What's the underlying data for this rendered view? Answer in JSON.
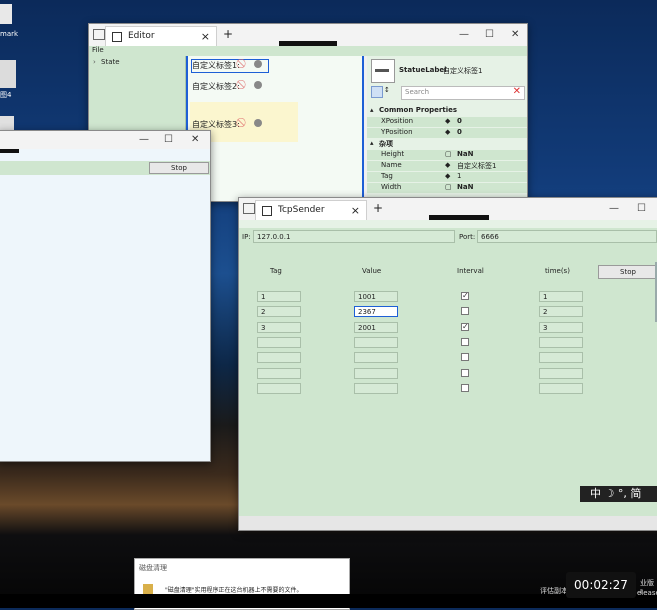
{
  "desktop": {
    "icon_label": "mark",
    "icon_label2": "图4"
  },
  "editor": {
    "tab_title": "Editor",
    "menu_file": "File",
    "tree_item": "State",
    "labels": [
      "自定义标签1:",
      "自定义标签2:",
      "自定义标签3:"
    ],
    "inspector": {
      "type": "StatueLabel",
      "name": "自定义标签1",
      "search_placeholder": "Search",
      "group_common": "Common Properties",
      "xposition_label": "XPosition",
      "xposition_value": "0",
      "yposition_label": "YPosition",
      "yposition_value": "0",
      "group_misc": "杂项",
      "height_label": "Height",
      "height_value": "NaN",
      "name_label": "Name",
      "name_value": "自定义标签1",
      "tag_label": "Tag",
      "tag_value": "1",
      "width_label": "Width",
      "width_value": "NaN"
    }
  },
  "bg_window": {
    "stop": "Stop"
  },
  "tcp": {
    "tab_title": "TcpSender",
    "ip_label": "IP:",
    "ip_value": "127.0.0.1",
    "port_label": "Port:",
    "port_value": "6666",
    "col_tag": "Tag",
    "col_value": "Value",
    "col_interval": "Interval",
    "col_time": "time(s)",
    "stop": "Stop",
    "rows": [
      {
        "tag": "1",
        "value": "1001",
        "checked": true,
        "time": "1"
      },
      {
        "tag": "2",
        "value": "2367",
        "checked": false,
        "time": "2"
      },
      {
        "tag": "3",
        "value": "2001",
        "checked": true,
        "time": "3"
      },
      {
        "tag": "",
        "value": "",
        "checked": false,
        "time": ""
      },
      {
        "tag": "",
        "value": "",
        "checked": false,
        "time": ""
      },
      {
        "tag": "",
        "value": "",
        "checked": false,
        "time": ""
      },
      {
        "tag": "",
        "value": "",
        "checked": false,
        "time": ""
      }
    ]
  },
  "ime": {
    "text": "中 ☽ °, 简"
  },
  "notification": {
    "title": "磁盘清理",
    "body": "\"磁盘清理\"实用程序正在这台机器上不需要的文件。"
  },
  "taskbar": {
    "clock": "00:02:27",
    "tray1": "业版 I",
    "tray2": "elease",
    "tray3": "评估副本"
  },
  "colors": {
    "panel_green": "#cfe6cf",
    "accent_blue": "#1e5fd6"
  }
}
